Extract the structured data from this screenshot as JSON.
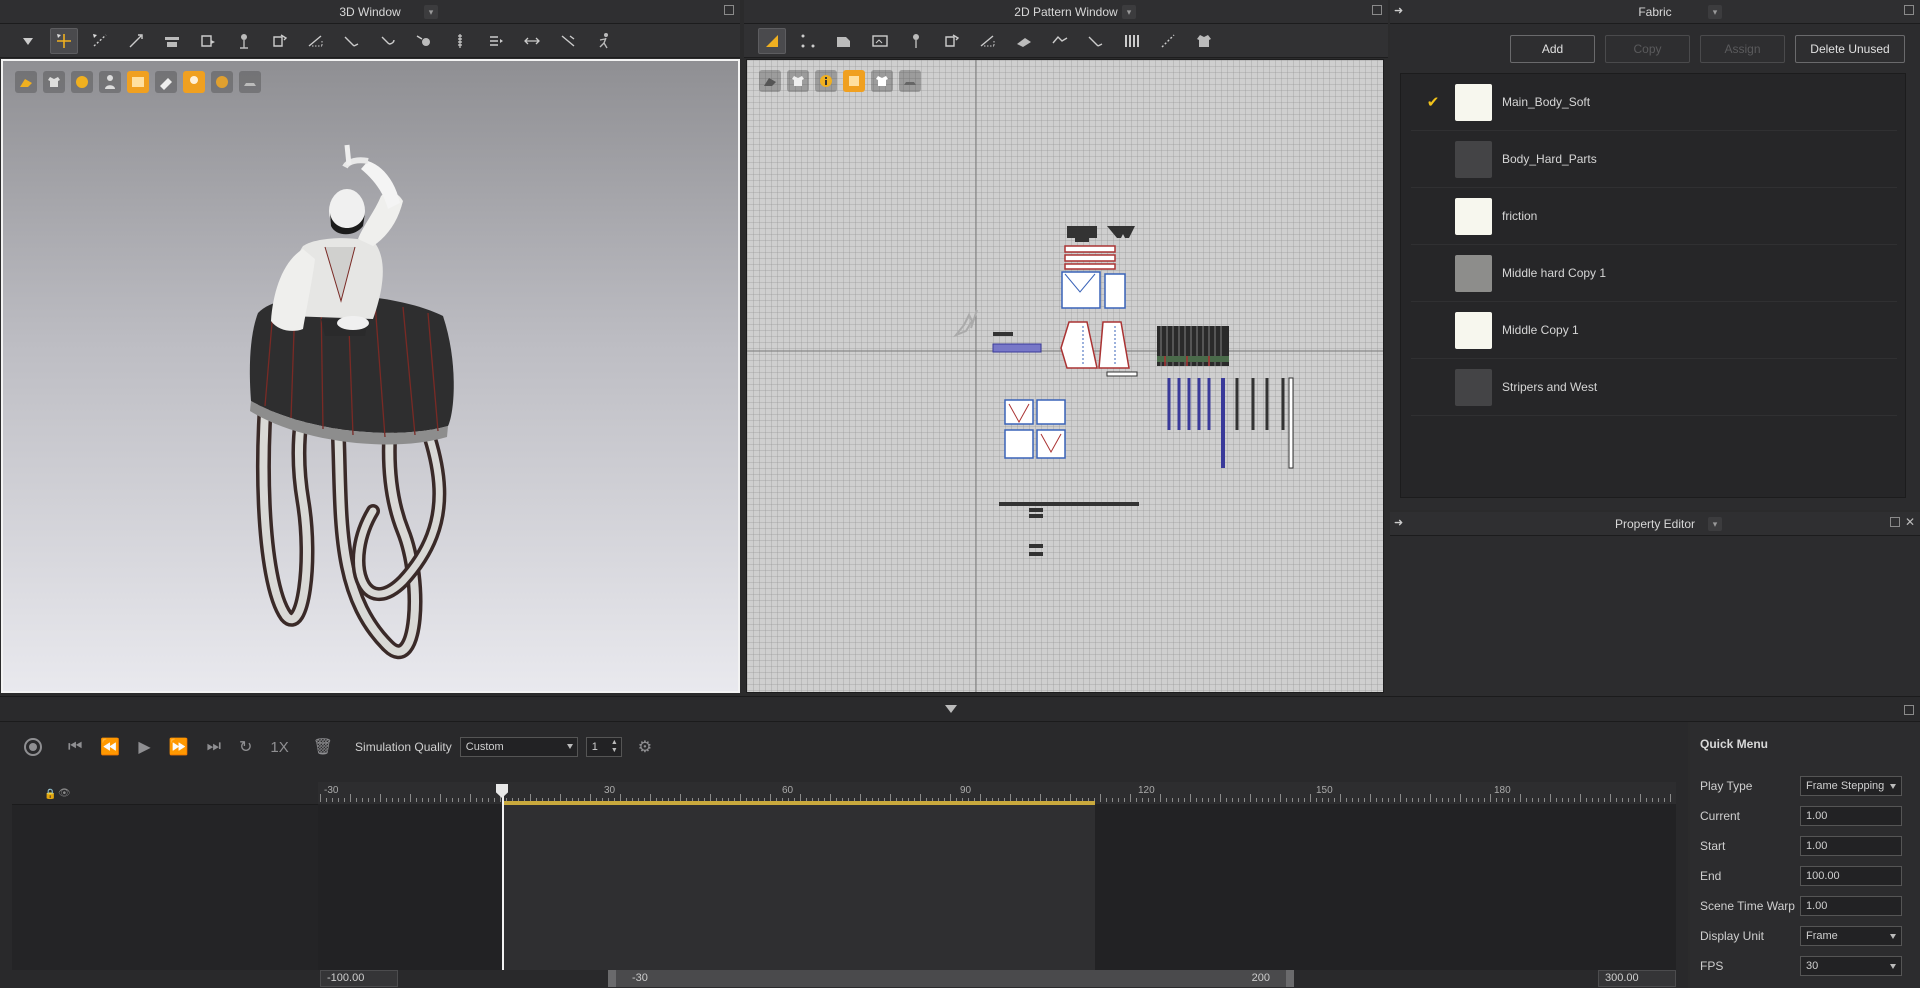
{
  "window3d": {
    "title": "3D Window"
  },
  "window2d": {
    "title": "2D Pattern Window"
  },
  "fabric": {
    "title": "Fabric",
    "buttons": {
      "add": "Add",
      "copy": "Copy",
      "assign": "Assign",
      "delete_unused": "Delete Unused"
    },
    "items": [
      {
        "name": "Main_Body_Soft",
        "color": "#f7f7ee",
        "selected": true
      },
      {
        "name": "Body_Hard_Parts",
        "color": "#444446",
        "selected": false
      },
      {
        "name": "friction",
        "color": "#f7f7ee",
        "selected": false
      },
      {
        "name": "Middle hard Copy 1",
        "color": "#8d8d8b",
        "selected": false
      },
      {
        "name": "Middle Copy 1",
        "color": "#f7f7ee",
        "selected": false
      },
      {
        "name": "Stripers and West",
        "color": "#444446",
        "selected": false
      }
    ]
  },
  "property_editor": {
    "title": "Property Editor"
  },
  "animation": {
    "speed": "1X",
    "simulation_quality_label": "Simulation Quality",
    "simulation_quality_value": "Custom",
    "step_value": "1",
    "ruler_ticks": [
      "-30",
      "30",
      "60",
      "90",
      "120",
      "150",
      "180"
    ],
    "range_start": "-100.00",
    "range_end": "300.00",
    "scroll_start": "-30",
    "scroll_end": "200"
  },
  "quick_menu": {
    "title": "Quick Menu",
    "rows": [
      {
        "label": "Play Type",
        "value": "Frame Stepping",
        "dropdown": true
      },
      {
        "label": "Current",
        "value": "1.00",
        "dropdown": false
      },
      {
        "label": "Start",
        "value": "1.00",
        "dropdown": false
      },
      {
        "label": "End",
        "value": "100.00",
        "dropdown": false
      },
      {
        "label": "Scene Time Warp",
        "value": "1.00",
        "dropdown": false
      },
      {
        "label": "Display Unit",
        "value": "Frame",
        "dropdown": true
      },
      {
        "label": "FPS",
        "value": "30",
        "dropdown": true
      }
    ]
  }
}
